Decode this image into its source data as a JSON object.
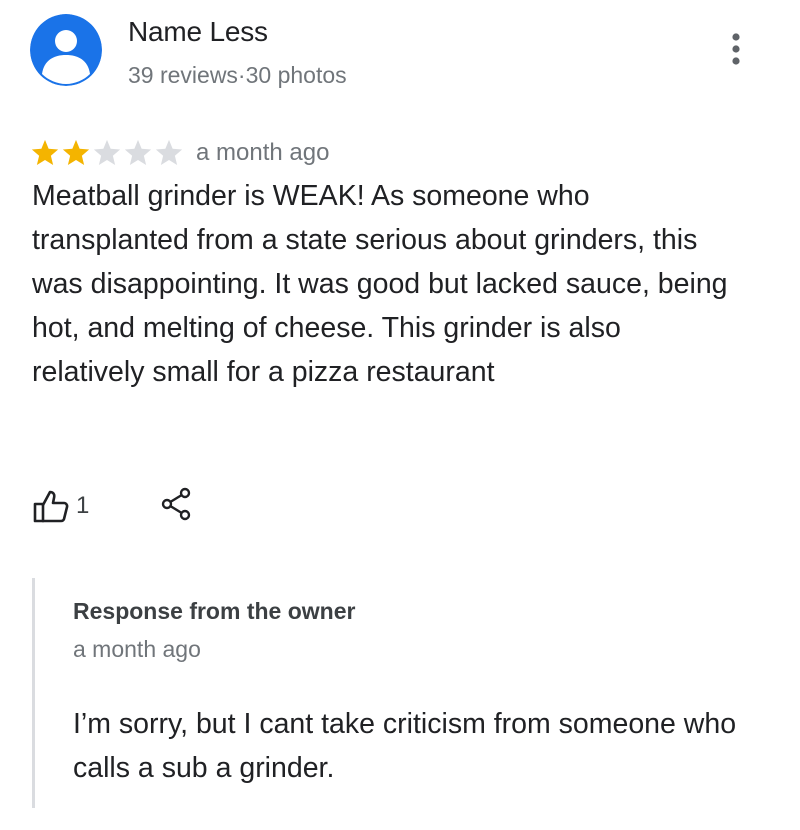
{
  "reviewer": {
    "name": "Name Less",
    "meta": "39 reviews·30 photos",
    "avatar_color": "#1a73e8"
  },
  "review": {
    "rating": 2,
    "max_rating": 5,
    "date": "a month ago",
    "text": "Meatball grinder is WEAK! As someone who transplanted from a state serious about grinders, this was disappointing. It was good but lacked sauce, being hot, and melting of cheese. This grinder is also relatively small for a pizza restaurant",
    "like_count": "1"
  },
  "owner_response": {
    "title": "Response from the owner",
    "date": "a month ago",
    "text": "I’m sorry, but I cant take criticism from someone who calls a sub a grinder."
  },
  "colors": {
    "star_filled": "#f4b400",
    "star_empty": "#dadce0",
    "secondary_text": "#70757a",
    "response_border": "#dadce0"
  },
  "icons": {
    "more": "more-vert-icon",
    "like": "thumb-up-icon",
    "share": "share-icon",
    "avatar": "person-icon",
    "star": "star-icon"
  }
}
